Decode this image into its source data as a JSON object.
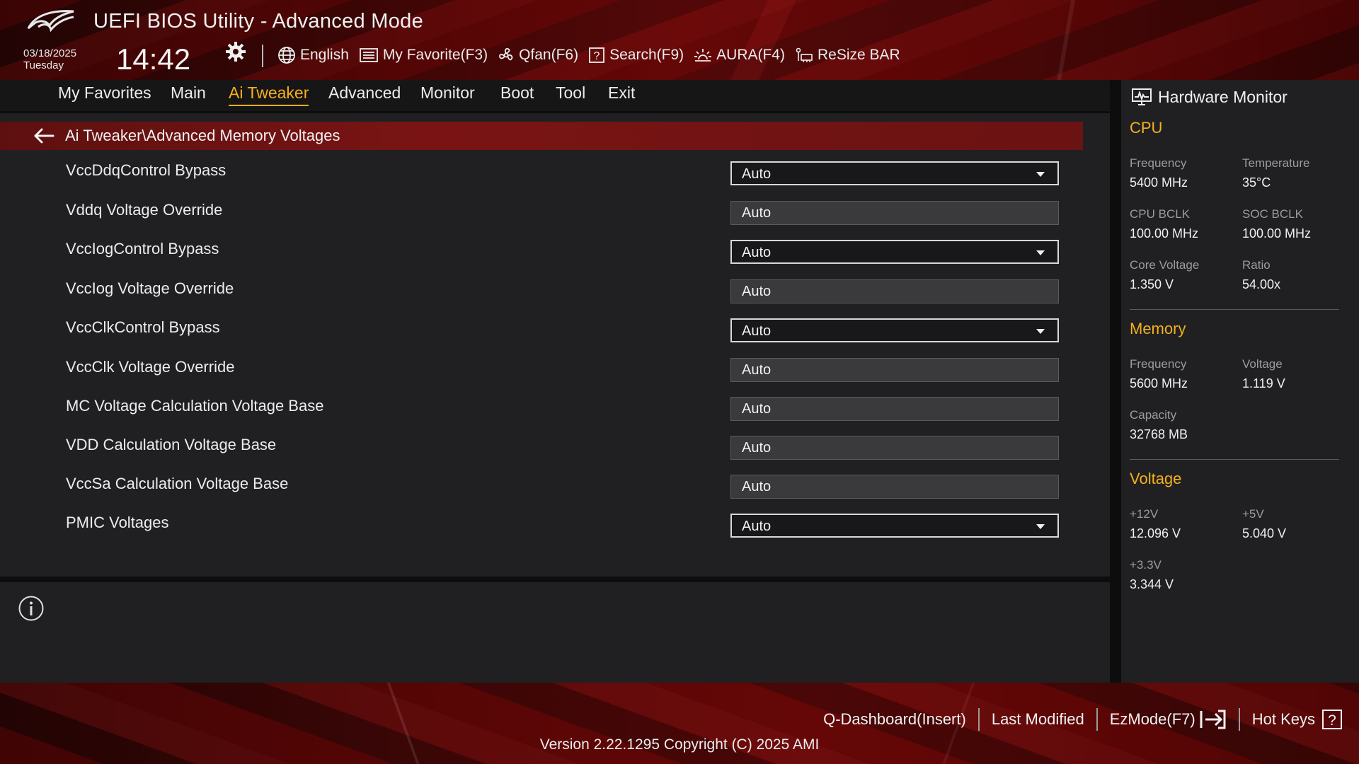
{
  "header": {
    "title": "UEFI BIOS Utility - Advanced Mode",
    "date": "03/18/2025",
    "day": "Tuesday",
    "time": "14:42",
    "toolbar": [
      {
        "icon": "globe-icon",
        "label": "English"
      },
      {
        "icon": "favorite-list-icon",
        "label": "My Favorite(F3)"
      },
      {
        "icon": "fan-icon",
        "label": "Qfan(F6)"
      },
      {
        "icon": "search-help-icon",
        "label": "Search(F9)"
      },
      {
        "icon": "aura-light-icon",
        "label": "AURA(F4)"
      },
      {
        "icon": "resize-bar-icon",
        "label": "ReSize BAR"
      }
    ]
  },
  "nav": {
    "tabs": [
      "My Favorites",
      "Main",
      "Ai Tweaker",
      "Advanced",
      "Monitor",
      "Boot",
      "Tool",
      "Exit"
    ],
    "active": "Ai Tweaker"
  },
  "main": {
    "breadcrumb": "Ai Tweaker\\Advanced Memory Voltages",
    "settings": [
      {
        "label": "VccDdqControl Bypass",
        "value": "Auto",
        "type": "select"
      },
      {
        "label": "Vddq Voltage Override",
        "value": "Auto",
        "type": "text"
      },
      {
        "label": "VccIogControl Bypass",
        "value": "Auto",
        "type": "select"
      },
      {
        "label": "VccIog Voltage Override",
        "value": "Auto",
        "type": "text"
      },
      {
        "label": "VccClkControl Bypass",
        "value": "Auto",
        "type": "select"
      },
      {
        "label": "VccClk Voltage Override",
        "value": "Auto",
        "type": "text"
      },
      {
        "label": "MC Voltage Calculation Voltage Base",
        "value": "Auto",
        "type": "text"
      },
      {
        "label": "VDD Calculation Voltage Base",
        "value": "Auto",
        "type": "text"
      },
      {
        "label": "VccSa Calculation Voltage Base",
        "value": "Auto",
        "type": "text"
      },
      {
        "label": "PMIC Voltages",
        "value": "Auto",
        "type": "select"
      }
    ]
  },
  "hw_monitor": {
    "title": "Hardware Monitor",
    "cpu": {
      "title": "CPU",
      "frequency_label": "Frequency",
      "frequency": "5400 MHz",
      "temperature_label": "Temperature",
      "temperature": "35°C",
      "cpu_bclk_label": "CPU BCLK",
      "cpu_bclk": "100.00 MHz",
      "soc_bclk_label": "SOC BCLK",
      "soc_bclk": "100.00 MHz",
      "core_voltage_label": "Core Voltage",
      "core_voltage": "1.350 V",
      "ratio_label": "Ratio",
      "ratio": "54.00x"
    },
    "memory": {
      "title": "Memory",
      "frequency_label": "Frequency",
      "frequency": "5600 MHz",
      "voltage_label": "Voltage",
      "voltage": "1.119 V",
      "capacity_label": "Capacity",
      "capacity": "32768 MB"
    },
    "voltage": {
      "title": "Voltage",
      "v12_label": "+12V",
      "v12": "12.096 V",
      "v5_label": "+5V",
      "v5": "5.040 V",
      "v33_label": "+3.3V",
      "v33": "3.344 V"
    }
  },
  "footer": {
    "qdashboard": "Q-Dashboard(Insert)",
    "last_modified": "Last Modified",
    "ezmode": "EzMode(F7)",
    "hotkeys": "Hot Keys",
    "version": "Version 2.22.1295 Copyright (C) 2025 AMI"
  },
  "colors": {
    "accent": "#f4b01c",
    "breadcrumb_bar": "#7a1414",
    "panel": "#202022"
  }
}
